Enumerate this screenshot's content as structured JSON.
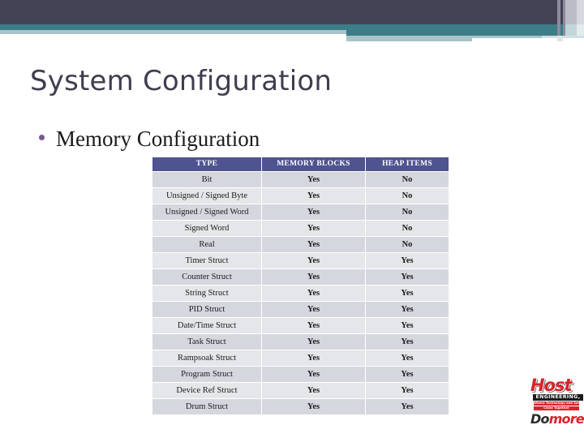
{
  "banner": {
    "colors": {
      "dark": "#434355",
      "teal": "#3d7d87",
      "pale_teal": "#a9c4c8",
      "pale_teal_light": "#cfe0e2",
      "stripe_gray": "#8b8b9c",
      "stripe_light": "#bcbcc6"
    }
  },
  "slide": {
    "title": "System Configuration",
    "title_color": "#3e3e4f"
  },
  "bullets": [
    {
      "text": "Memory Configuration",
      "marker": "bullet-dot",
      "marker_color": "#7a5a8e"
    }
  ],
  "table": {
    "headers": [
      "TYPE",
      "MEMORY BLOCKS",
      "HEAP ITEMS"
    ],
    "header_bg": "#4f5390",
    "header_fg": "#ffffff",
    "row_bg_a": "#d5d7de",
    "row_bg_b": "#e5e6ea",
    "yes_color": "#1a7a4e",
    "no_color": "#dd2222",
    "rows": [
      {
        "type": "Bit",
        "memory_blocks": "Yes",
        "heap_items": "No"
      },
      {
        "type": "Unsigned / Signed Byte",
        "memory_blocks": "Yes",
        "heap_items": "No"
      },
      {
        "type": "Unsigned / Signed Word",
        "memory_blocks": "Yes",
        "heap_items": "No"
      },
      {
        "type": "Signed Word",
        "memory_blocks": "Yes",
        "heap_items": "No"
      },
      {
        "type": "Real",
        "memory_blocks": "Yes",
        "heap_items": "No"
      },
      {
        "type": "Timer Struct",
        "memory_blocks": "Yes",
        "heap_items": "Yes"
      },
      {
        "type": "Counter Struct",
        "memory_blocks": "Yes",
        "heap_items": "Yes"
      },
      {
        "type": "String Struct",
        "memory_blocks": "Yes",
        "heap_items": "Yes"
      },
      {
        "type": "PID Struct",
        "memory_blocks": "Yes",
        "heap_items": "Yes"
      },
      {
        "type": "Date/Time Struct",
        "memory_blocks": "Yes",
        "heap_items": "Yes"
      },
      {
        "type": "Task Struct",
        "memory_blocks": "Yes",
        "heap_items": "Yes"
      },
      {
        "type": "Rampsoak Struct",
        "memory_blocks": "Yes",
        "heap_items": "Yes"
      },
      {
        "type": "Program Struct",
        "memory_blocks": "Yes",
        "heap_items": "Yes"
      },
      {
        "type": "Device Ref Struct",
        "memory_blocks": "Yes",
        "heap_items": "Yes"
      },
      {
        "type": "Drum Struct",
        "memory_blocks": "Yes",
        "heap_items": "Yes"
      }
    ]
  },
  "logo": {
    "brand": "Host",
    "subtitle": "ENGINEERING, INC.",
    "tagline_line1": "Where Technology and Service",
    "tagline_line2": "Come Together",
    "slogan_prefix": "Do",
    "slogan_suffix": "more!",
    "brand_color": "#d8232a"
  }
}
